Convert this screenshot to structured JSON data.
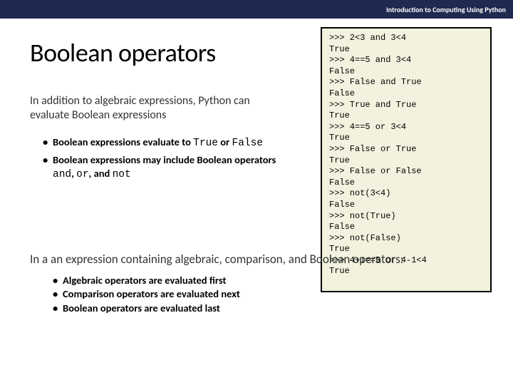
{
  "header": "Introduction to Computing Using Python",
  "title": "Boolean operators",
  "intro": "In addition to algebraic expressions, Python can evaluate Boolean expressions",
  "bullets": [
    {
      "pre": "Boolean expressions evaluate to ",
      "code": "True",
      "mid": " or ",
      "code2": "False",
      "post": ""
    },
    {
      "pre": "Boolean expressions may include Boolean operators ",
      "code": "and",
      "mid": ", ",
      "code2": "or",
      "post": ", and ",
      "code3": "not"
    }
  ],
  "code_lines": ">>> 2<3 and 3<4\nTrue\n>>> 4==5 and 3<4\nFalse\n>>> False and True\nFalse\n>>> True and True\nTrue\n>>> 4==5 or 3<4\nTrue\n>>> False or True\nTrue\n>>> False or False\nFalse\n>>> not(3<4)\nFalse\n>>> not(True)\nFalse\n>>> not(False)\nTrue\n>>> 4+1==5 or 4-1<4\nTrue",
  "footer_intro": "In a an expression containing algebraic, comparison, and Boolean operators:",
  "footer_bullets": [
    "Algebraic operators are evaluated first",
    "Comparison operators are evaluated next",
    "Boolean operators are evaluated last"
  ]
}
